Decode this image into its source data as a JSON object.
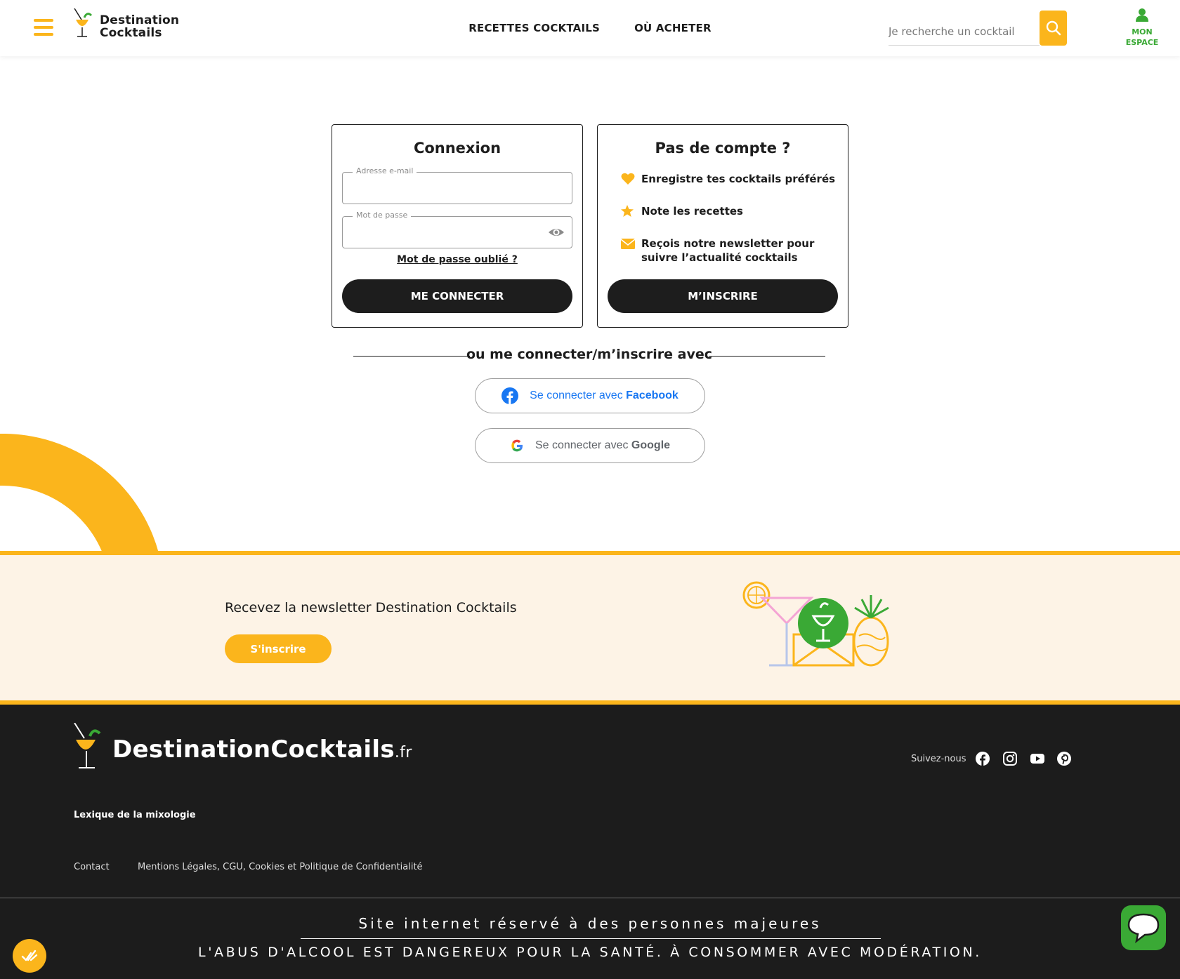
{
  "header": {
    "logo_line1": "Destination",
    "logo_line2": "Cocktails",
    "nav": [
      "RECETTES COCKTAILS",
      "OÙ ACHETER"
    ],
    "search_placeholder": "Je recherche un cocktail",
    "account_label_1": "MON",
    "account_label_2": "ESPACE"
  },
  "login": {
    "title": "Connexion",
    "email_label": "Adresse e-mail",
    "email_value": "",
    "password_label": "Mot de passe",
    "password_value": "",
    "forgot": "Mot de passe oublié ?",
    "submit": "ME CONNECTER"
  },
  "signup": {
    "title": "Pas de compte ?",
    "perks": [
      {
        "icon": "heart-icon",
        "text": "Enregistre tes cocktails préférés"
      },
      {
        "icon": "star-icon",
        "text": "Note les recettes"
      },
      {
        "icon": "envelope-icon",
        "text": "Reçois notre newsletter pour suivre l’actualité cocktails"
      }
    ],
    "submit": "M’INSCRIRE"
  },
  "social": {
    "separator": "ou me connecter/m’inscrire avec",
    "facebook_prefix": "Se connecter avec ",
    "facebook_brand": "Facebook",
    "google_prefix": "Se connecter avec ",
    "google_brand": "Google"
  },
  "newsletter": {
    "title": "Recevez la newsletter Destination Cocktails",
    "button": "S'inscrire"
  },
  "footer": {
    "logo_main": "DestinationCocktails",
    "logo_tld": ".fr",
    "follow": "Suivez-nous",
    "lexique": "Lexique de la mixologie",
    "contact": "Contact",
    "legal": "Mentions Légales, CGU, Cookies et Politique de Confidentialité",
    "warning1": "Site internet réservé à des personnes majeures",
    "warning2": "L'ABUS D'ALCOOL EST DANGEREUX POUR LA SANTÉ. À CONSOMMER AVEC MODÉRATION."
  },
  "colors": {
    "brand_yellow": "#fbb51c",
    "brand_green": "#3aa935",
    "dark": "#1c1c1c",
    "cream": "#fdf3e6"
  }
}
